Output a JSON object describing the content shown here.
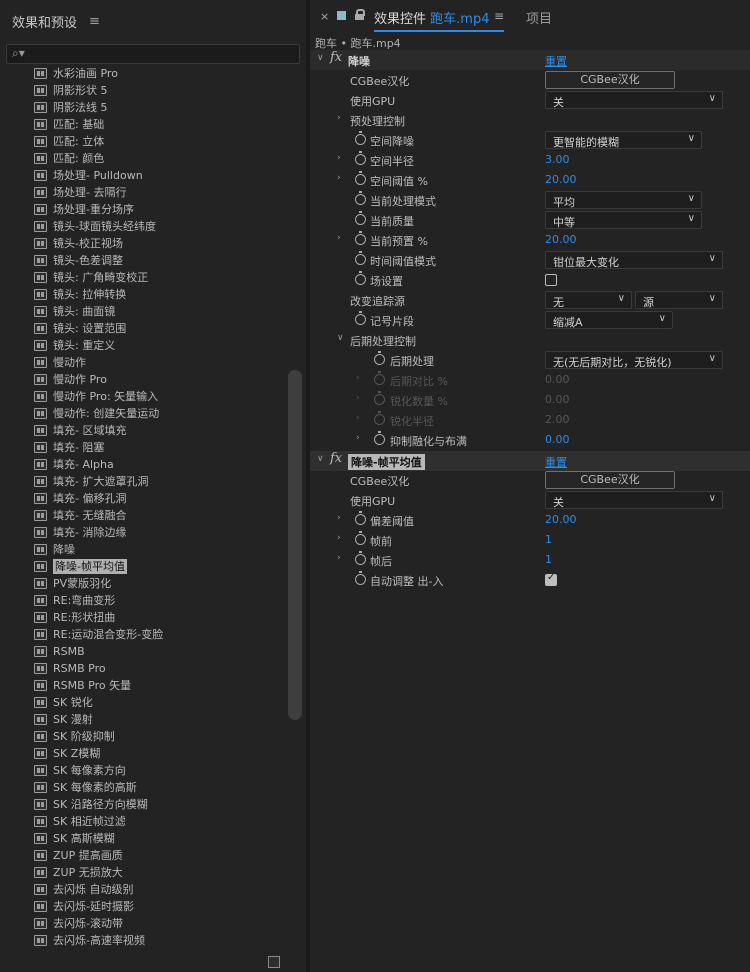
{
  "left_panel": {
    "title": "效果和预设",
    "menu_icon": "≡",
    "search": {
      "icon": "⌕▾",
      "value": "",
      "placeholder": ""
    },
    "items": [
      {
        "label": "水彩油画 Pro"
      },
      {
        "label": "阴影形状 5"
      },
      {
        "label": "阴影法线 5"
      },
      {
        "label": "匹配: 基础"
      },
      {
        "label": "匹配: 立体"
      },
      {
        "label": "匹配: 颜色"
      },
      {
        "label": "场处理- Pulldown"
      },
      {
        "label": "场处理- 去隔行"
      },
      {
        "label": "场处理-重分场序"
      },
      {
        "label": "镜头-球面镜头经纬度"
      },
      {
        "label": "镜头-校正视场"
      },
      {
        "label": "镜头-色差调整"
      },
      {
        "label": "镜头: 广角畸变校正"
      },
      {
        "label": "镜头: 拉伸转换"
      },
      {
        "label": "镜头: 曲面镜"
      },
      {
        "label": "镜头: 设置范围"
      },
      {
        "label": "镜头: 重定义"
      },
      {
        "label": "慢动作"
      },
      {
        "label": "慢动作 Pro"
      },
      {
        "label": "慢动作 Pro: 矢量输入"
      },
      {
        "label": "慢动作: 创建矢量运动"
      },
      {
        "label": "填充- 区域填充"
      },
      {
        "label": "填充- 阻塞"
      },
      {
        "label": "填充- Alpha"
      },
      {
        "label": "填充- 扩大遮罩孔洞"
      },
      {
        "label": "填充- 偏移孔洞"
      },
      {
        "label": "填充- 无缝融合"
      },
      {
        "label": "填充- 消除边缘"
      },
      {
        "label": "降噪"
      },
      {
        "label": "降噪-帧平均值",
        "selected": true
      },
      {
        "label": "PV蒙版羽化"
      },
      {
        "label": "RE:弯曲变形"
      },
      {
        "label": "RE:形状扭曲"
      },
      {
        "label": "RE:运动混合变形-变脸"
      },
      {
        "label": "RSMB"
      },
      {
        "label": "RSMB Pro"
      },
      {
        "label": "RSMB Pro 矢量"
      },
      {
        "label": "SK 锐化"
      },
      {
        "label": "SK 漫射"
      },
      {
        "label": "SK 阶级抑制"
      },
      {
        "label": "SK Z模糊"
      },
      {
        "label": "SK 每像素方向"
      },
      {
        "label": "SK 每像素的高斯"
      },
      {
        "label": "SK 沿路径方向模糊"
      },
      {
        "label": "SK 相近帧过滤"
      },
      {
        "label": "SK 高斯模糊"
      },
      {
        "label": "ZUP 提高画质"
      },
      {
        "label": "ZUP 无损放大"
      },
      {
        "label": "去闪烁 自动级别"
      },
      {
        "label": "去闪烁-延时摄影"
      },
      {
        "label": "去闪烁-滚动带"
      },
      {
        "label": "去闪烁-高速率视频"
      }
    ]
  },
  "right_panel": {
    "tab_close": "×",
    "tab_active_prefix": "效果控件",
    "tab_active_clip": "跑车.mp4",
    "tab_menu": "≡",
    "tab_project": "项目",
    "breadcrumb": "跑车 • 跑车.mp4",
    "effect1": {
      "title": "降噪",
      "reset": "重置",
      "cgbee_label": "CGBee汉化",
      "cgbee_button": "CGBee汉化",
      "gpu_label": "使用GPU",
      "gpu_value": "关",
      "pre_group": "预处理控制",
      "spatial_mode_label": "空间降噪",
      "spatial_mode_value": "更智能的模糊",
      "spatial_radius_label": "空间半径",
      "spatial_radius_value": "3.00",
      "spatial_threshold_label": "空间阈值 %",
      "spatial_threshold_value": "20.00",
      "pre_mode_label": "当前处理模式",
      "pre_mode_value": "平均",
      "quality_label": "当前质量",
      "quality_value": "中等",
      "preset_label": "当前预置 %",
      "preset_value": "20.00",
      "temporal_label": "时间阈值模式",
      "temporal_value": "钳位最大变化",
      "field_label": "场设置",
      "tracking_label": "改变追踪源",
      "tracking_value1": "无",
      "tracking_value2": "源",
      "clip_label": "记号片段",
      "clip_value": "缩减A",
      "post_group": "后期处理控制",
      "post_label": "后期处理",
      "post_value": "无(无后期对比，无锐化)",
      "post_contrast_label": "后期对比 %",
      "post_contrast_value": "0.00",
      "sharpen_amount_label": "锐化数量 %",
      "sharpen_amount_value": "0.00",
      "sharpen_radius_label": "锐化半径",
      "sharpen_radius_value": "2.00",
      "suppress_label": "抑制融化与布满",
      "suppress_value": "0.00"
    },
    "effect2": {
      "title": "降噪-帧平均值",
      "reset": "重置",
      "cgbee_label": "CGBee汉化",
      "cgbee_button": "CGBee汉化",
      "gpu_label": "使用GPU",
      "gpu_value": "关",
      "deviation_label": "偏差阈值",
      "deviation_value": "20.00",
      "frames_before_label": "帧前",
      "frames_before_value": "1",
      "frames_after_label": "帧后",
      "frames_after_value": "1",
      "auto_label": "自动调整 出-入"
    }
  }
}
